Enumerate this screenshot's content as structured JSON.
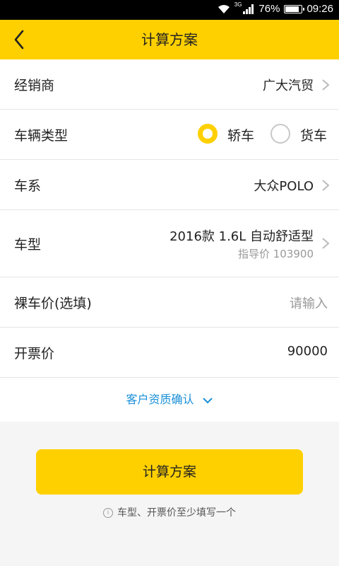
{
  "status_bar": {
    "network": "3G",
    "battery": "76%",
    "battery_level": 0.76,
    "time": "09:26"
  },
  "header": {
    "title": "计算方案"
  },
  "form": {
    "dealer": {
      "label": "经销商",
      "value": "广大汽贸"
    },
    "vehicle_type": {
      "label": "车辆类型",
      "options": [
        "轿车",
        "货车"
      ],
      "selected": "轿车"
    },
    "series": {
      "label": "车系",
      "value": "大众POLO"
    },
    "model": {
      "label": "车型",
      "value": "2016款 1.6L 自动舒适型",
      "guide_price": "指导价 103900"
    },
    "bare_price": {
      "label": "裸车价(选填)",
      "placeholder": "请输入"
    },
    "invoice_price": {
      "label": "开票价",
      "value": "90000"
    }
  },
  "customer_confirm": {
    "label": "客户资质确认"
  },
  "submit": {
    "label": "计算方案"
  },
  "hint": {
    "icon_text": "i",
    "text": "车型、开票价至少填写一个"
  },
  "colors": {
    "accent": "#ffd000",
    "link": "#1a8fd8"
  }
}
